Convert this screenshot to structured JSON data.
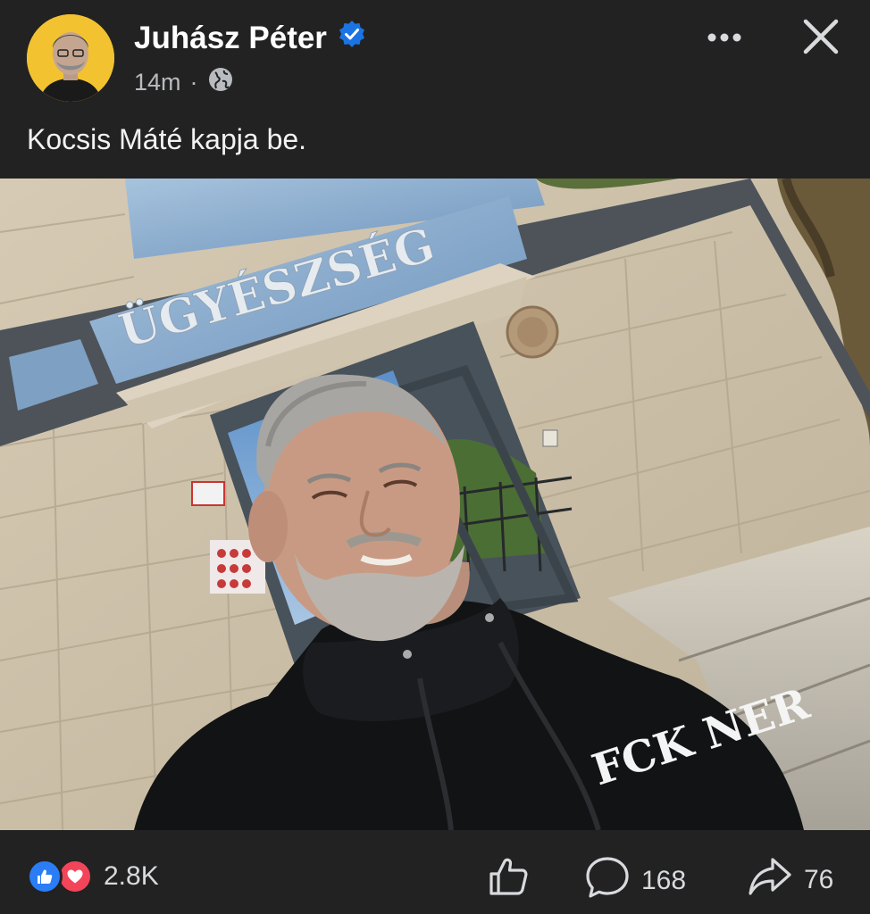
{
  "post": {
    "author": "Juhász Péter",
    "time": "14m",
    "separator": "·",
    "caption": "Kocsis Máté kapja be."
  },
  "photo": {
    "building_sign": "ÜGYÉSZSÉG",
    "hoodie_text": "FCK NER"
  },
  "footer": {
    "reaction_count": "2.8K",
    "comment_count": "168",
    "share_count": "76"
  },
  "icons": {
    "verified": "verified-badge-icon",
    "audience": "globe-icon",
    "more": "more-options-icon",
    "close": "close-icon",
    "like_reaction": "like-reaction-icon",
    "love_reaction": "love-reaction-icon",
    "like_action": "thumbs-up-icon",
    "comment_action": "comment-icon",
    "share_action": "share-icon"
  },
  "colors": {
    "background": "#222222",
    "verified_blue": "#1b74e4",
    "like_blue": "#2a7df5",
    "love_red": "#f2455a",
    "avatar_yellow": "#f2c230"
  }
}
